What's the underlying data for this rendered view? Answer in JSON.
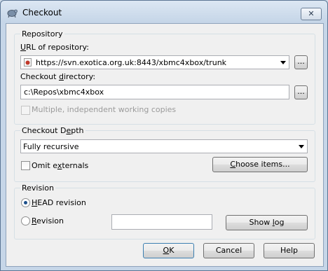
{
  "window": {
    "title": "Checkout",
    "close_label": "✕"
  },
  "repository": {
    "legend": "Repository",
    "url_label_u": "U",
    "url_label_rest": "RL of repository:",
    "url_value": "https://svn.exotica.org.uk:8443/xbmc4xbox/trunk",
    "browse_label": "...",
    "dir_label_a": "Checkout ",
    "dir_label_u": "d",
    "dir_label_b": "irectory:",
    "dir_value": "c:\\Repos\\xbmc4xbox",
    "multiple_label": "Multiple, independent working copies"
  },
  "depth": {
    "legend_a": "Checkout D",
    "legend_u": "e",
    "legend_b": "pth",
    "value": "Fully recursive",
    "omit_a": "Omit e",
    "omit_u": "x",
    "omit_b": "ternals",
    "choose_u": "C",
    "choose_rest": "hoose items..."
  },
  "revision": {
    "legend": "Revision",
    "head_u": "H",
    "head_rest": "EAD revision",
    "rev_u": "R",
    "rev_rest": "evision",
    "rev_value": "",
    "showlog_a": "Show ",
    "showlog_u": "l",
    "showlog_b": "og"
  },
  "buttons": {
    "ok_u": "O",
    "ok_rest": "K",
    "cancel": "Cancel",
    "help": "Help"
  },
  "colors": {
    "accent": "#1c4f8a",
    "frame": "#5b7594"
  }
}
